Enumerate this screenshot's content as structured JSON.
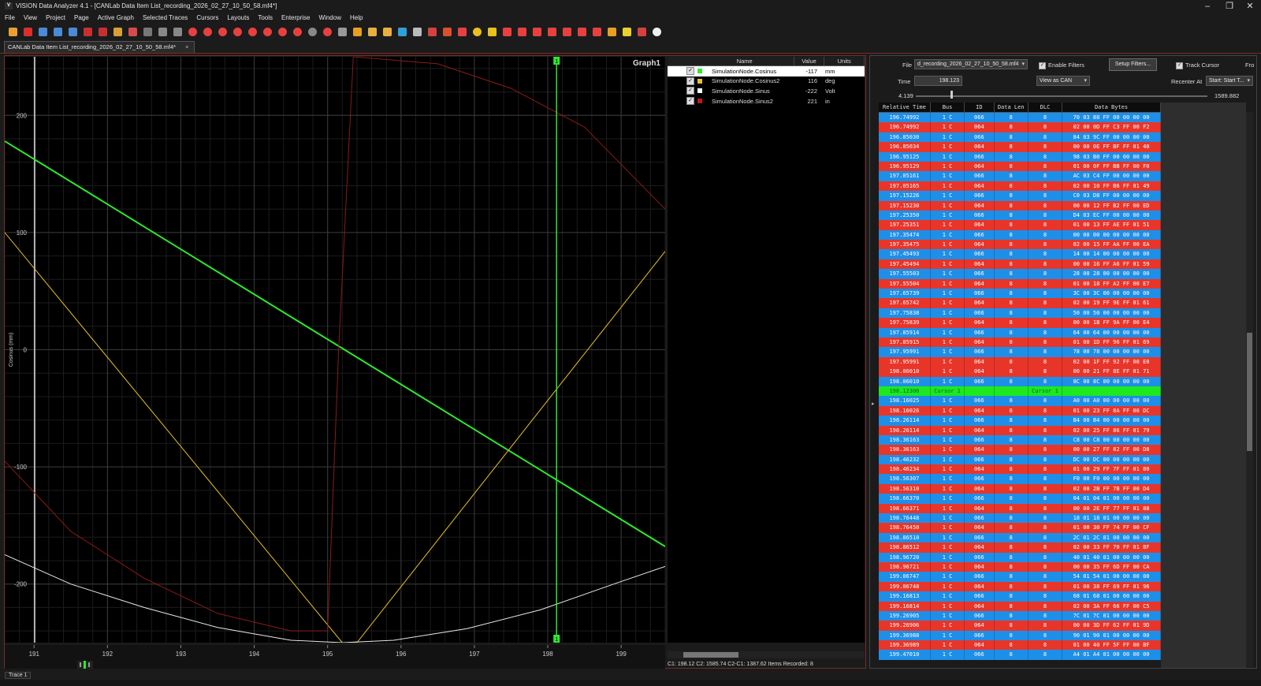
{
  "window": {
    "title": "VISION Data Analyzer 4.1 - [CANLab Data Item List_recording_2026_02_27_10_50_58.mf4*]",
    "app_icon": "V",
    "controls": [
      "minimize-icon",
      "restore-icon",
      "close-icon"
    ]
  },
  "menu": [
    "File",
    "View",
    "Project",
    "Page",
    "Active Graph",
    "Selected Traces",
    "Cursors",
    "Layouts",
    "Tools",
    "Enterprise",
    "Window",
    "Help"
  ],
  "toolbar_icons": [
    "open-icon",
    "close-file-icon",
    "save-icon",
    "save-all-icon",
    "save-as-icon",
    "record-icon",
    "trace-icon",
    "abc-icon",
    "table-icon",
    "lasso-icon",
    "select-icon",
    "line-tool-icon",
    "zoom-in-icon",
    "zoom-in-x-icon",
    "zoom-out-icon",
    "zoom-out-x-icon",
    "zoom-fit-icon",
    "zoom-box-icon",
    "zoom-y-icon",
    "zoom-prev-icon",
    "zoom-reset-icon",
    "zoom-all-icon",
    "scroll-left-icon",
    "scroll-right-icon",
    "waterfall-icon",
    "bar-chart-icon",
    "multi-graph-icon",
    "check-graph-icon",
    "color-icon",
    "grid-icon",
    "slope-icon",
    "target-icon",
    "cursor-count-icon",
    "step-icon",
    "cursor-a-icon",
    "cursor-b-icon",
    "cursor-c-icon",
    "cursor-d-icon",
    "cursor-e-icon",
    "cursor-f-icon",
    "markers-icon",
    "note-icon",
    "image-icon",
    "toggle-icon"
  ],
  "tab": {
    "label": "CANLab Data Item List_recording_2026_02_27_10_50_58.mf4*",
    "close": "×"
  },
  "graph": {
    "name": "Graph1",
    "ylabel": "Cosinus (mm)",
    "y_ticks": [
      "200",
      "100",
      "0",
      "-100",
      "-200"
    ],
    "x_ticks": [
      "191",
      "192",
      "193",
      "194",
      "195",
      "196",
      "197",
      "198",
      "199"
    ],
    "cursor_label": "1",
    "trace_label": "Trace 1"
  },
  "chart_data": {
    "type": "line",
    "x_range": [
      190.6,
      199.6
    ],
    "y_range": [
      -250,
      250
    ],
    "grid": true,
    "cursor_x": 198.12,
    "series": [
      {
        "name": "SimulationNode.Cosinus",
        "color": "#2ee82e",
        "x": [
          190.6,
          199.6
        ],
        "y": [
          178,
          -168
        ]
      },
      {
        "name": "SimulationNode.Cosinus2",
        "color": "#e8c22a",
        "x": [
          190.6,
          195.2,
          195.4,
          199.6
        ],
        "y": [
          100,
          -250,
          -250,
          84
        ]
      },
      {
        "name": "SimulationNode.Sinus",
        "color": "#e8e8e8",
        "x": [
          190.6,
          191.5,
          192.5,
          193.5,
          194.5,
          195.2,
          195.9,
          196.9,
          197.9,
          198.9,
          199.6
        ],
        "y": [
          -175,
          -200,
          -220,
          -237,
          -248,
          -250,
          -248,
          -238,
          -222,
          -200,
          -185
        ]
      },
      {
        "name": "SimulationNode.Sinus2",
        "color": "#8a1a1a",
        "x": [
          190.6,
          191.5,
          192.5,
          193.5,
          194.5,
          195.0,
          195.15,
          195.35,
          196.5,
          197.5,
          198.5,
          199.6
        ],
        "y": [
          -95,
          -155,
          -195,
          -225,
          -240,
          -240,
          0,
          250,
          244,
          223,
          190,
          120
        ]
      }
    ]
  },
  "signals": {
    "headers": [
      "Name",
      "Value",
      "Units"
    ],
    "rows": [
      {
        "name": "SimulationNode.Cosinus",
        "value": "-117",
        "unit": "mm",
        "color": "#2ee82e"
      },
      {
        "name": "SimulationNode.Cosinus2",
        "value": "116",
        "unit": "deg",
        "color": "#e8c22a"
      },
      {
        "name": "SimulationNode.Sinus",
        "value": "-222",
        "unit": "Volt",
        "color": "#ffffff"
      },
      {
        "name": "SimulationNode.Sinus2",
        "value": "221",
        "unit": "in",
        "color": "#c0181b"
      }
    ],
    "check": "✓",
    "readout": "C1: 198.12    C2: 1585.74    C2-C1: 1387.62    Items Recorded: 8"
  },
  "controls": {
    "file_label": "File",
    "file_value": "d_recording_2026_02_27_10_50_58.mf4",
    "enable_filters": "Enable Filters",
    "setup_filters": "Setup Filters...",
    "track_cursor": "Track Cursor",
    "fro_label": "Fro",
    "time_label": "Time",
    "time_value": "198.123",
    "view_as": "View as CAN",
    "recenter_label": "Recenter At",
    "recenter_value": "Start: Start T...",
    "slider_min": "4.139",
    "slider_max": "1589.882",
    "slider_position": 0.122
  },
  "table": {
    "headers": [
      "Relative Time",
      "Bus",
      "ID",
      "Data Len",
      "DLC",
      "Data Bytes"
    ],
    "rows": [
      [
        "196.74992",
        "1 C",
        "066",
        "8",
        "8",
        "70 03 88 FF 00 00 00 00",
        "blue"
      ],
      [
        "196.74992",
        "1 C",
        "064",
        "8",
        "8",
        "02 00 0D FF C3 FF 00 F2",
        "red"
      ],
      [
        "196.85030",
        "1 C",
        "066",
        "8",
        "8",
        "84 03 9C FF 00 00 00 00",
        "blue"
      ],
      [
        "196.85034",
        "1 C",
        "064",
        "8",
        "8",
        "00 00 0E FF BF FF 01 40",
        "red"
      ],
      [
        "196.95125",
        "1 C",
        "066",
        "8",
        "8",
        "98 03 B0 FF 00 00 00 00",
        "blue"
      ],
      [
        "196.95129",
        "1 C",
        "064",
        "8",
        "8",
        "01 00 0F FF BB FF 00 F0",
        "red"
      ],
      [
        "197.05161",
        "1 C",
        "066",
        "8",
        "8",
        "AC 03 C4 FF 00 00 00 00",
        "blue"
      ],
      [
        "197.05165",
        "1 C",
        "064",
        "8",
        "8",
        "02 00 10 FF B6 FF 01 49",
        "red"
      ],
      [
        "197.15226",
        "1 C",
        "066",
        "8",
        "8",
        "C0 03 D8 FF 00 00 00 00",
        "blue"
      ],
      [
        "197.15230",
        "1 C",
        "064",
        "8",
        "8",
        "00 00 12 FF B2 FF 00 ED",
        "red"
      ],
      [
        "197.25350",
        "1 C",
        "066",
        "8",
        "8",
        "D4 03 EC FF 00 00 00 00",
        "blue"
      ],
      [
        "197.25351",
        "1 C",
        "064",
        "8",
        "8",
        "01 00 13 FF AE FF 01 51",
        "red"
      ],
      [
        "197.35474",
        "1 C",
        "066",
        "8",
        "8",
        "00 00 00 00 00 00 00 00",
        "blue"
      ],
      [
        "197.35475",
        "1 C",
        "064",
        "8",
        "8",
        "02 00 15 FF AA FF 00 EA",
        "red"
      ],
      [
        "197.45493",
        "1 C",
        "066",
        "8",
        "8",
        "14 00 14 00 00 00 00 00",
        "blue"
      ],
      [
        "197.45494",
        "1 C",
        "064",
        "8",
        "8",
        "00 00 16 FF A6 FF 01 59",
        "red"
      ],
      [
        "197.55503",
        "1 C",
        "066",
        "8",
        "8",
        "28 00 28 00 00 00 00 00",
        "blue"
      ],
      [
        "197.55504",
        "1 C",
        "064",
        "8",
        "8",
        "01 00 18 FF A2 FF 00 E7",
        "red"
      ],
      [
        "197.65739",
        "1 C",
        "066",
        "8",
        "8",
        "3C 00 3C 00 00 00 00 00",
        "blue"
      ],
      [
        "197.65742",
        "1 C",
        "064",
        "8",
        "8",
        "02 00 19 FF 9E FF 01 61",
        "red"
      ],
      [
        "197.75838",
        "1 C",
        "066",
        "8",
        "8",
        "50 00 50 00 00 00 00 00",
        "blue"
      ],
      [
        "197.75839",
        "1 C",
        "064",
        "8",
        "8",
        "00 00 1B FF 9A FF 00 E4",
        "red"
      ],
      [
        "197.85914",
        "1 C",
        "066",
        "8",
        "8",
        "64 00 64 00 00 00 00 00",
        "blue"
      ],
      [
        "197.85915",
        "1 C",
        "064",
        "8",
        "8",
        "01 00 1D FF 96 FF 01 69",
        "red"
      ],
      [
        "197.95991",
        "1 C",
        "066",
        "8",
        "8",
        "78 00 78 00 00 00 00 00",
        "blue"
      ],
      [
        "197.95991",
        "1 C",
        "064",
        "8",
        "8",
        "02 00 1F FF 92 FF 00 E0",
        "red"
      ],
      [
        "198.06010",
        "1 C",
        "064",
        "8",
        "8",
        "00 00 21 FF 8E FF 01 71",
        "red"
      ],
      [
        "198.06010",
        "1 C",
        "066",
        "8",
        "8",
        "8C 00 8C 00 00 00 00 00",
        "blue"
      ],
      [
        "198.12306",
        "Cursor 1",
        "",
        "",
        "Cursor 1",
        "",
        "green"
      ],
      [
        "198.16025",
        "1 C",
        "066",
        "8",
        "8",
        "A0 00 A0 00 00 00 00 00",
        "blue"
      ],
      [
        "198.16026",
        "1 C",
        "064",
        "8",
        "8",
        "01 00 23 FF 8A FF 00 DC",
        "red"
      ],
      [
        "198.26114",
        "1 C",
        "066",
        "8",
        "8",
        "B4 00 B4 00 00 00 00 00",
        "blue"
      ],
      [
        "198.26114",
        "1 C",
        "064",
        "8",
        "8",
        "02 00 25 FF 86 FF 01 79",
        "red"
      ],
      [
        "198.36163",
        "1 C",
        "066",
        "8",
        "8",
        "C8 00 C8 00 00 00 00 00",
        "blue"
      ],
      [
        "198.36163",
        "1 C",
        "064",
        "8",
        "8",
        "00 00 27 FF 82 FF 00 D8",
        "red"
      ],
      [
        "198.46232",
        "1 C",
        "066",
        "8",
        "8",
        "DC 00 DC 00 00 00 00 00",
        "blue"
      ],
      [
        "198.46234",
        "1 C",
        "064",
        "8",
        "8",
        "01 00 29 FF 7F FF 01 80",
        "red"
      ],
      [
        "198.56307",
        "1 C",
        "066",
        "8",
        "8",
        "F0 00 F0 00 00 00 00 00",
        "blue"
      ],
      [
        "198.56310",
        "1 C",
        "064",
        "8",
        "8",
        "02 00 2B FF 7B FF 00 D4",
        "red"
      ],
      [
        "198.66370",
        "1 C",
        "066",
        "8",
        "8",
        "04 01 04 01 00 00 00 00",
        "blue"
      ],
      [
        "198.66371",
        "1 C",
        "064",
        "8",
        "8",
        "00 00 2E FF 77 FF 01 88",
        "red"
      ],
      [
        "198.76448",
        "1 C",
        "066",
        "8",
        "8",
        "18 01 18 01 00 00 00 00",
        "blue"
      ],
      [
        "198.76450",
        "1 C",
        "064",
        "8",
        "8",
        "01 00 30 FF 74 FF 00 CF",
        "red"
      ],
      [
        "198.86510",
        "1 C",
        "066",
        "8",
        "8",
        "2C 01 2C 01 00 00 00 00",
        "blue"
      ],
      [
        "198.86512",
        "1 C",
        "064",
        "8",
        "8",
        "02 00 33 FF 70 FF 01 8F",
        "red"
      ],
      [
        "198.96720",
        "1 C",
        "066",
        "8",
        "8",
        "40 01 40 01 00 00 00 00",
        "blue"
      ],
      [
        "198.96721",
        "1 C",
        "064",
        "8",
        "8",
        "00 00 35 FF 6D FF 00 CA",
        "red"
      ],
      [
        "199.06747",
        "1 C",
        "066",
        "8",
        "8",
        "54 01 54 01 00 00 00 00",
        "blue"
      ],
      [
        "199.06748",
        "1 C",
        "064",
        "8",
        "8",
        "01 00 38 FF 69 FF 01 96",
        "red"
      ],
      [
        "199.16813",
        "1 C",
        "066",
        "8",
        "8",
        "68 01 68 01 00 00 00 00",
        "blue"
      ],
      [
        "199.16814",
        "1 C",
        "064",
        "8",
        "8",
        "02 00 3A FF 66 FF 00 C5",
        "red"
      ],
      [
        "199.26905",
        "1 C",
        "066",
        "8",
        "8",
        "7C 01 7C 01 00 00 00 00",
        "blue"
      ],
      [
        "199.26906",
        "1 C",
        "064",
        "8",
        "8",
        "00 00 3D FF 62 FF 01 9D",
        "red"
      ],
      [
        "199.36988",
        "1 C",
        "066",
        "8",
        "8",
        "90 01 90 01 00 00 00 00",
        "blue"
      ],
      [
        "199.36989",
        "1 C",
        "064",
        "8",
        "8",
        "01 00 40 FF 5F FF 00 BF",
        "red"
      ],
      [
        "199.47010",
        "1 C",
        "066",
        "8",
        "8",
        "A4 01 A4 01 00 00 00 00",
        "blue"
      ]
    ]
  }
}
